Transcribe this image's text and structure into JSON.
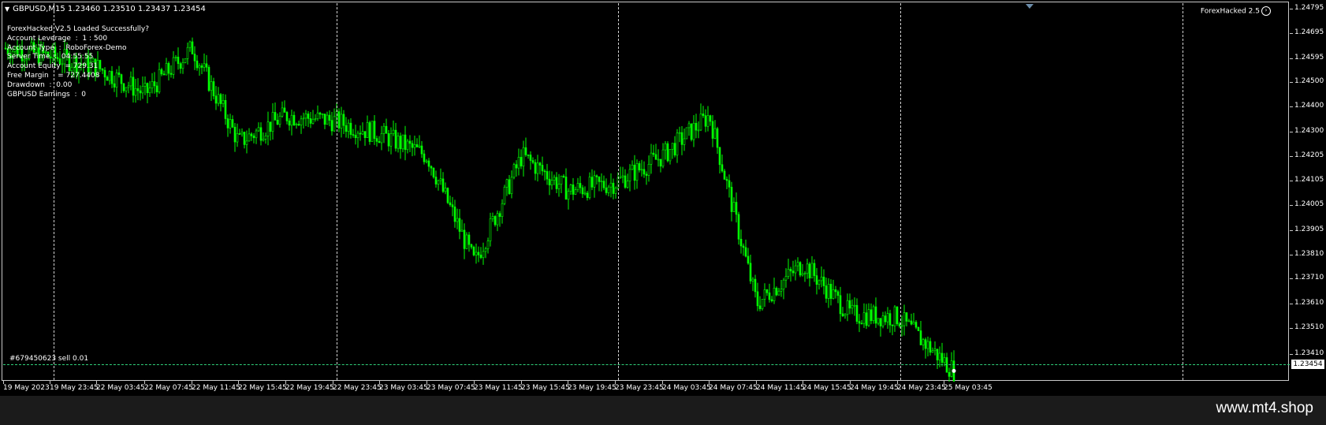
{
  "header": {
    "symbol_line": "GBPUSD,M15  1.23460 1.23510 1.23437 1.23454",
    "ea_label": "ForexHacked 2.5",
    "smile_icon": "smiley-face-icon"
  },
  "info_panel": {
    "lines": [
      "ForexHacked V2.5 Loaded Successfully?",
      "Account Leverage  :  1 : 500",
      "Account Type  :  RoboForex-Demo",
      "Server Time  :  04:55:55",
      "Account Equity  = 729.31",
      "Free Margin    = 727.4408",
      "Drawdown  :  0.00",
      "GBPUSD Earnings  :  0"
    ]
  },
  "order": {
    "label": "#679450623 sell 0.01"
  },
  "price_axis": {
    "labels": [
      "1.24795",
      "1.24695",
      "1.24595",
      "1.24500",
      "1.24400",
      "1.24300",
      "1.24205",
      "1.24105",
      "1.24005",
      "1.23905",
      "1.23810",
      "1.23710",
      "1.23610",
      "1.23510",
      "1.23410"
    ],
    "current_price": "1.23454"
  },
  "time_axis": {
    "labels": [
      "19 May 2023",
      "19 May 23:45",
      "22 May 03:45",
      "22 May 07:45",
      "22 May 11:45",
      "22 May 15:45",
      "22 May 19:45",
      "22 May 23:45",
      "23 May 03:45",
      "23 May 07:45",
      "23 May 11:45",
      "23 May 15:45",
      "23 May 19:45",
      "23 May 23:45",
      "24 May 03:45",
      "24 May 07:45",
      "24 May 11:45",
      "24 May 15:45",
      "24 May 19:45",
      "24 May 23:45",
      "25 May 03:45"
    ]
  },
  "colors": {
    "background": "#000000",
    "candle": "#00ff00",
    "order_line": "#2fd27a",
    "grid": "#d0d0d0"
  },
  "chart_data": {
    "type": "line",
    "title": "GBPUSD,M15",
    "ylim": [
      1.2341,
      1.2482
    ],
    "x": [
      "19 May 2023",
      "19 May 23:45",
      "22 May 03:45",
      "22 May 07:45",
      "22 May 11:45",
      "22 May 15:45",
      "22 May 19:45",
      "22 May 23:45",
      "23 May 03:45",
      "23 May 07:45",
      "23 May 11:45",
      "23 May 15:45",
      "23 May 19:45",
      "23 May 23:45",
      "24 May 03:45",
      "24 May 07:45",
      "24 May 11:45",
      "24 May 15:45",
      "24 May 19:45",
      "24 May 23:45",
      "25 May 03:45"
    ],
    "series": [
      {
        "values": [
          1.2465,
          1.2462,
          1.2458,
          1.2448,
          1.2465,
          1.243,
          1.244,
          1.2438,
          1.2433,
          1.2425,
          1.2385,
          1.2425,
          1.2412,
          1.2415,
          1.2425,
          1.244,
          1.237,
          1.2385,
          1.2366,
          1.2365,
          1.2345
        ]
      }
    ]
  }
}
